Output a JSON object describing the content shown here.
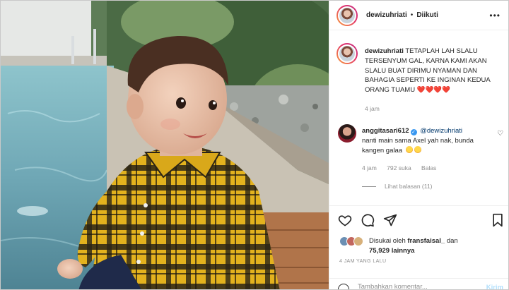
{
  "post": {
    "username": "dewizuhriati",
    "separator": "•",
    "follow_state": "Diikuti",
    "more_label": "•••"
  },
  "caption": {
    "username": "dewizuhriati",
    "text": "TETAPLAH LAH SLALU TERSENYUM GAL, KARNA KAMI AKAN SLALU BUAT DIRIMU NYAMAN DAN BAHAGIA SEPERTI KE INGINAN KEDUA ORANG TUAMU",
    "hearts": "❤️❤️❤️❤️",
    "time": "4 jam"
  },
  "comment": {
    "username": "anggitasari612",
    "mention": "@dewizuhriati",
    "text": "nanti main sama Axel yah nak, bunda kangen galaa",
    "time": "4 jam",
    "likes": "792 suka",
    "reply_label": "Balas",
    "view_replies": "Lihat balasan (11)"
  },
  "likes": {
    "prefix": "Disukai oleh",
    "user": "fransfaisal_",
    "conj": "dan",
    "count": "75,929 lainnya"
  },
  "post_time": "4 JAM YANG LALU",
  "add_comment": {
    "placeholder": "Tambahkan komentar...",
    "send_label": "Kirim"
  },
  "icons": {
    "like": "heart-icon",
    "comment": "comment-icon",
    "share": "share-icon",
    "save": "bookmark-icon",
    "emoji": "smile-icon"
  },
  "colors": {
    "verified": "#3897f0",
    "mention": "#00376b",
    "muted": "#8e8e8e",
    "send_disabled": "#b2dffc"
  }
}
